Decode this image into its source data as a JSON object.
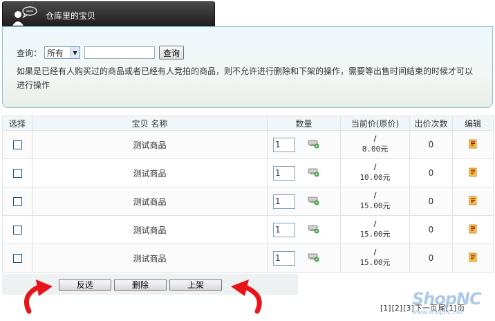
{
  "header": {
    "title": "仓库里的宝贝"
  },
  "query": {
    "label": "查询：",
    "select_value": "所有",
    "input_value": "",
    "button_label": "查询",
    "notice": "如果是已经有人购买过的商品或者已经有人竞拍的商品，则不允许进行删除和下架的操作，需要等出售时间结束的时候才可以进行操作"
  },
  "table": {
    "headers": [
      "选择",
      "宝贝 名称",
      "数量",
      "当前价(原价)",
      "出价次数",
      "编辑"
    ],
    "rows": [
      {
        "name": "测试商品",
        "quantity": "1",
        "price_sep": "/",
        "price": "8.00元",
        "bids": "0"
      },
      {
        "name": "测试商品",
        "quantity": "1",
        "price_sep": "/",
        "price": "10.00元",
        "bids": "0"
      },
      {
        "name": "测试商品",
        "quantity": "1",
        "price_sep": "/",
        "price": "15.00元",
        "bids": "0"
      },
      {
        "name": "测试商品",
        "quantity": "1",
        "price_sep": "/",
        "price": "15.00元",
        "bids": "0"
      },
      {
        "name": "测试商品",
        "quantity": "1",
        "price_sep": "/",
        "price": "15.00元",
        "bids": "0"
      }
    ]
  },
  "actions": {
    "invert": "反选",
    "delete": "删除",
    "shelve": "上架"
  },
  "pager": {
    "pages": [
      "[1]",
      "[2]",
      "[3]"
    ],
    "next": "下一页",
    "last": "尾[1]",
    "end": "页"
  },
  "watermark": {
    "brand": "ShopNC",
    "url": "www.shopnc.net"
  },
  "colors": {
    "tab_bg": "#1d1d1d",
    "panel_border": "#8fc0d0",
    "arrow": "#e8141a"
  }
}
